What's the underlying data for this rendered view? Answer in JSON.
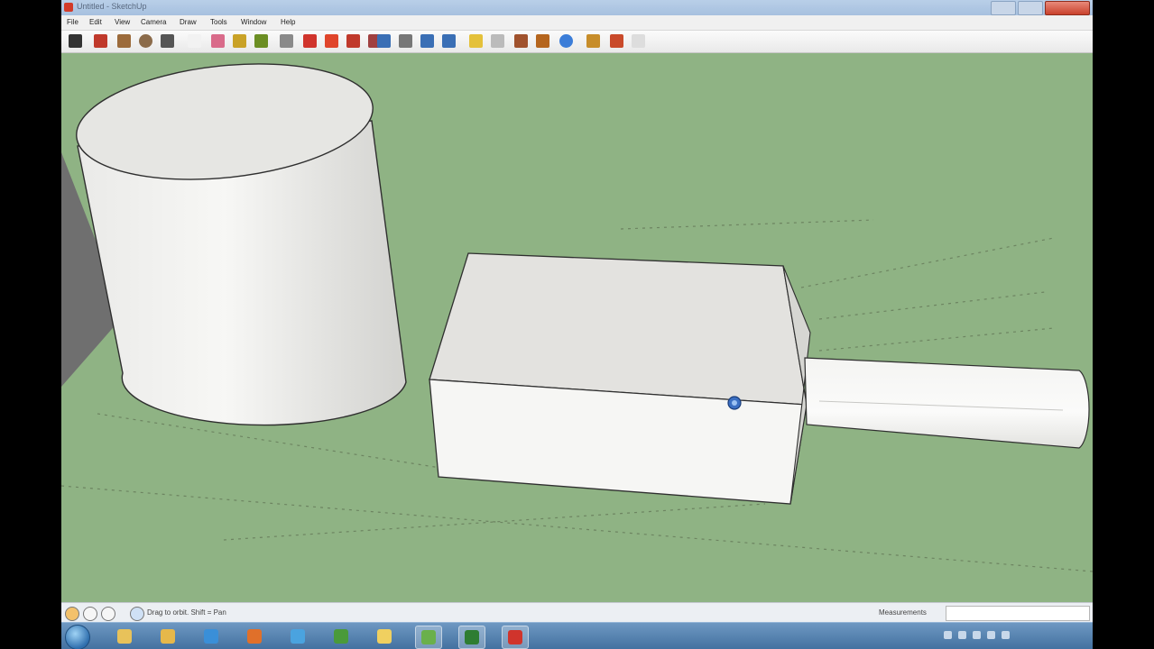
{
  "window": {
    "title": "Untitled - SketchUp"
  },
  "menu": [
    "File",
    "Edit",
    "View",
    "Camera",
    "Draw",
    "Tools",
    "Window",
    "Help"
  ],
  "toolbar": {
    "tools": [
      {
        "name": "select-tool-icon",
        "color": "#333333"
      },
      {
        "name": "pencil-tool-icon",
        "color": "#c0392b"
      },
      {
        "name": "rectangle-tool-icon",
        "color": "#9c6b3b"
      },
      {
        "name": "circle-tool-icon",
        "color": "#8b6b4a"
      },
      {
        "name": "arc-tool-icon",
        "color": "#555555"
      },
      {
        "name": "make-component-icon",
        "color": "#f2f2f2"
      },
      {
        "name": "eraser-tool-icon",
        "color": "#d96b8a"
      },
      {
        "name": "tape-measure-icon",
        "color": "#c9a227"
      },
      {
        "name": "paint-bucket-icon",
        "color": "#6b8e23"
      },
      {
        "name": "push-pull-icon",
        "color": "#8a8a8a"
      },
      {
        "name": "move-tool-icon",
        "color": "#d0342c"
      },
      {
        "name": "rotate-tool-icon",
        "color": "#e0452b"
      },
      {
        "name": "follow-me-icon",
        "color": "#c0392b"
      },
      {
        "name": "offset-tool-icon",
        "color": "#a04040"
      },
      {
        "name": "orbit-tool-icon",
        "color": "#3a6fb5"
      },
      {
        "name": "pan-tool-icon",
        "color": "#777777"
      },
      {
        "name": "zoom-tool-icon",
        "color": "#3a6fb5"
      },
      {
        "name": "zoom-extents-icon",
        "color": "#3a6fb5"
      },
      {
        "name": "get-models-icon",
        "color": "#e4c13a"
      },
      {
        "name": "share-model-icon",
        "color": "#bbbbbb"
      },
      {
        "name": "add-location-icon",
        "color": "#a0522d"
      },
      {
        "name": "toggle-terrain-icon",
        "color": "#b5651d"
      },
      {
        "name": "preview-google-earth-icon",
        "color": "#3b7dd8"
      },
      {
        "name": "get-photo-texture-icon",
        "color": "#c78d2a"
      },
      {
        "name": "extension-warehouse-icon",
        "color": "#c94a2a"
      },
      {
        "name": "component-options-icon",
        "color": "#dddddd"
      }
    ]
  },
  "status": {
    "message": "Drag to orbit.  Shift = Pan",
    "measurements_label": "Measurements",
    "measurements_value": ""
  },
  "taskbar": {
    "items": [
      {
        "name": "explorer-task-icon",
        "color": "#e8c25a",
        "active": false
      },
      {
        "name": "folder-task-icon",
        "color": "#e6b84a",
        "active": false
      },
      {
        "name": "ie-task-icon",
        "color": "#3a8fd8",
        "active": false
      },
      {
        "name": "firefox-task-icon",
        "color": "#e0702a",
        "active": false
      },
      {
        "name": "document-task-icon",
        "color": "#4aa3df",
        "active": false
      },
      {
        "name": "media-task-icon",
        "color": "#4a9a3a",
        "active": false
      },
      {
        "name": "messenger-task-icon",
        "color": "#f0d060",
        "active": false
      },
      {
        "name": "camtasia-task-icon",
        "color": "#6ab04c",
        "active": true
      },
      {
        "name": "recorder-task-icon",
        "color": "#2e7d32",
        "active": true
      },
      {
        "name": "sketchup-task-icon",
        "color": "#d0342c",
        "active": true
      }
    ]
  },
  "colors": {
    "ground": "#8fb384",
    "solid_face_light": "#f1f1ef",
    "solid_face_shade": "#d9d9d6",
    "edge": "#2f2f2f",
    "backdrop_face": "#6f6f6f"
  }
}
